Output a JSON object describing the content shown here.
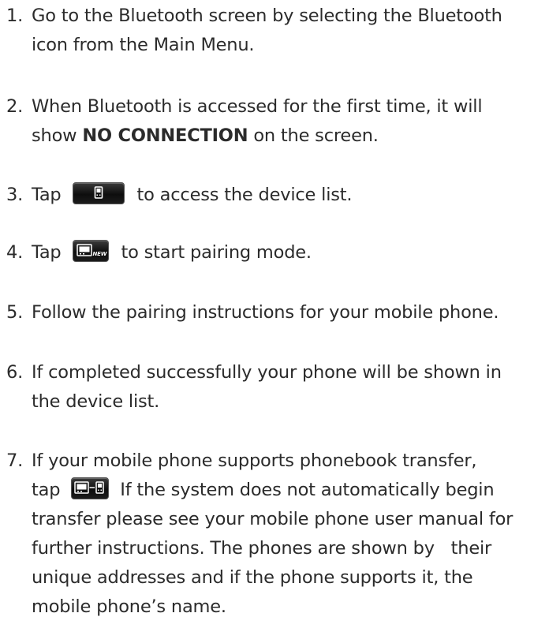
{
  "steps": [
    {
      "num": "1.",
      "lines": [
        "Go to the Bluetooth screen by selecting the Bluetooth",
        "icon from the Main Menu."
      ]
    },
    {
      "num": "2.",
      "line1": "When Bluetooth is accessed for the first time, it will",
      "line2_pre": "show ",
      "line2_bold": "NO CONNECTION",
      "line2_post": " on the screen."
    },
    {
      "num": "3.",
      "pre": "Tap",
      "post": "to access the device list.",
      "icon": "phone-device-icon"
    },
    {
      "num": "4.",
      "pre": "Tap",
      "post": "to start pairing mode.",
      "icon": "new-pairing-icon"
    },
    {
      "num": "5.",
      "lines": [
        "Follow the pairing instructions for your mobile phone."
      ]
    },
    {
      "num": "6.",
      "lines": [
        "If completed successfully your phone will be shown in",
        "the device list."
      ]
    },
    {
      "num": "7.",
      "line1": "If your mobile phone supports phonebook transfer,",
      "line2_pre": "tap",
      "line2_post": "If the system does not automatically begin",
      "icon": "phonebook-transfer-icon",
      "lines_rest": [
        "transfer please see your mobile phone user manual for",
        "further instructions. The phones are shown by   their",
        "unique addresses and if the phone supports it, the",
        "mobile phone’s name."
      ]
    }
  ],
  "icon_labels": {
    "new": "NEW"
  }
}
